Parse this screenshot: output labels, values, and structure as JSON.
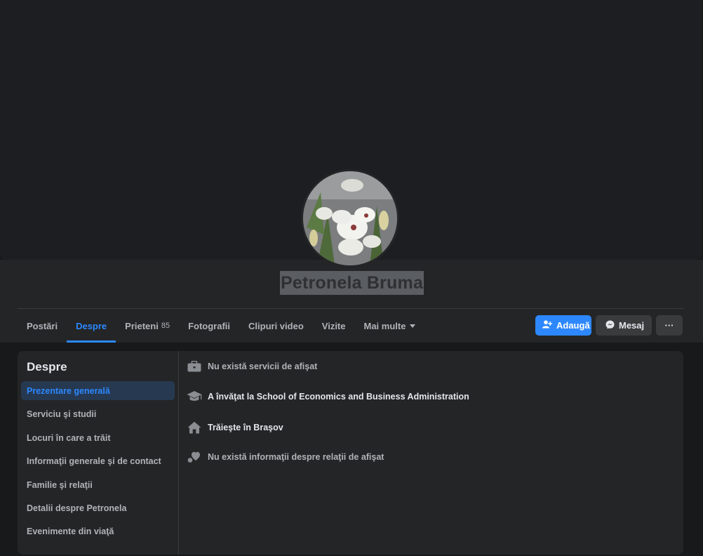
{
  "profile": {
    "name": "Petronela Bruma"
  },
  "tabs": [
    {
      "label": "Postări",
      "active": false
    },
    {
      "label": "Despre",
      "active": true
    },
    {
      "label": "Prieteni",
      "count": "85",
      "active": false
    },
    {
      "label": "Fotografii",
      "active": false
    },
    {
      "label": "Clipuri video",
      "active": false
    },
    {
      "label": "Vizite",
      "active": false
    },
    {
      "label": "Mai multe",
      "active": false
    }
  ],
  "actions": {
    "add_label": "Adaugă",
    "message_label": "Mesaj",
    "more_label": "···"
  },
  "about": {
    "title": "Despre",
    "items": [
      {
        "label": "Prezentare generală",
        "active": true
      },
      {
        "label": "Serviciu şi studii"
      },
      {
        "label": "Locuri în care a trăit"
      },
      {
        "label": "Informaţii generale şi de contact"
      },
      {
        "label": "Familie şi relaţii"
      },
      {
        "label": "Detalii despre Petronela"
      },
      {
        "label": "Evenimente din viaţă"
      }
    ],
    "overview": [
      {
        "icon": "briefcase-icon",
        "text": "Nu există servicii de afişat"
      },
      {
        "icon": "graduation-cap-icon",
        "text": "A învăţat la School of Economics and Business Administration"
      },
      {
        "icon": "home-icon",
        "text": "Trăieşte în Braşov"
      },
      {
        "icon": "heart-icon",
        "text": "Nu există informaţii despre relaţii de afişat"
      }
    ]
  },
  "colors": {
    "accent": "#2d88ff",
    "background": "#18191a",
    "card": "#242526"
  }
}
